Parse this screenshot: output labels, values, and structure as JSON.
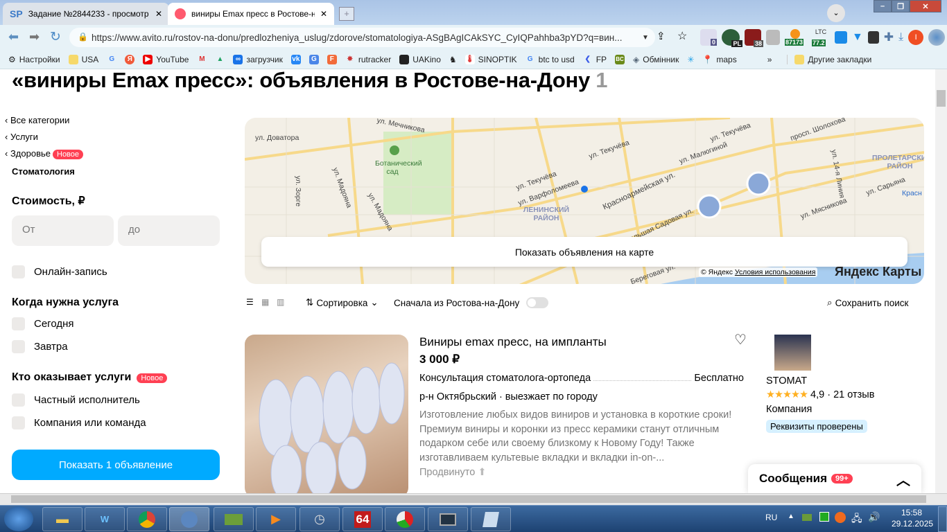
{
  "browser": {
    "tabs": [
      {
        "label": "Задание №2844233 - просмотр з",
        "icon": "SP"
      },
      {
        "label": "виниры Emax пресс в Ростове-на",
        "active": true
      }
    ],
    "url": "https://www.avito.ru/rostov-na-donu/predlozheniya_uslug/zdorove/stomatologiya-ASgBAgICAkSYC_CyIQPahhba3pYD?q=вин...",
    "extensions": {
      "weather": "0",
      "pl": "PL",
      "ublock": "38",
      "btc": "87173",
      "ltc_label": "LTC",
      "ltc": "77.2",
      "profile": "I"
    },
    "bookmarks": [
      "Настройки",
      "USA",
      "",
      "",
      "YouTube",
      "",
      "",
      "загрузчик",
      "",
      "",
      "",
      "rutracker",
      "UAKino",
      "",
      "SINOPTIK",
      "btc to usd",
      "FP",
      "BC",
      "Обмінник",
      "",
      "maps"
    ],
    "other_bookmarks": "Другие закладки",
    "more": "»"
  },
  "page": {
    "title": "«виниры Emax пресс»: объявления в Ростове-на-Дону",
    "count": "1",
    "breadcrumbs": [
      "Все категории",
      "Услуги",
      "Здоровье"
    ],
    "new_badge": "Новое",
    "current_category": "Стоматология",
    "price_label": "Стоимость, ₽",
    "price_from": "От",
    "price_to": "до",
    "online_booking": "Онлайн-запись",
    "when_label": "Когда нужна услуга",
    "when_options": [
      "Сегодня",
      "Завтра"
    ],
    "who_label": "Кто оказывает услуги",
    "who_options": [
      "Частный исполнитель",
      "Компания или команда"
    ],
    "show_button": "Показать 1 объявление",
    "map": {
      "button": "Показать объявления на карте",
      "copyright": "© Яндекс",
      "terms": "Условия использования",
      "logo": "Яндекс Карты",
      "labels": [
        "ул. Мечникова",
        "ул. Доватора",
        "Ботанический сад",
        "ул. Текучёва",
        "ул. Текучёва",
        "ул. Текучёва",
        "ул. Малюгиной",
        "просп. Шолохова",
        "ул. Варфоломеева",
        "Красноармейская ул.",
        "ЛЕНИНСКИЙ РАЙОН",
        "ПРОЛЕТАРСКИЙ РАЙОН",
        "ул. 14-я Линия",
        "ул. Сарьяна",
        "ул. Мясникова",
        "Большая Садовая ул.",
        "ул. Мадояна",
        "ул. Мадояна",
        "ул. Зорге",
        "Береговая ул.",
        "Красн"
      ]
    },
    "sort_label": "Сортировка",
    "local_first": "Сначала из Ростова-на-Дону",
    "save_search": "Сохранить поиск",
    "listing": {
      "title": "Виниры emax пресс, на импланты",
      "price": "3 000 ₽",
      "service": "Консультация стоматолога-ортопеда",
      "service_price": "Бесплатно",
      "location": "р-н Октябрьский · выезжает по городу",
      "description": "Изготовление любых видов виниров и установка в короткие сроки! Премиум виниры и коронки из пресс керамики станут отличным подарком себе или своему близкому к Новому Году! Также изготавливаем культевые вкладки и вкладки in-on-...",
      "promoted": "Продвинуто",
      "seller": "STOMAT",
      "rating": 4.9,
      "rating_text": "4,9 · 21 отзыв",
      "seller_type": "Компания",
      "verified": "Реквизиты проверены"
    },
    "messages": "Сообщения",
    "messages_count": "99+"
  },
  "taskbar": {
    "lang": "RU",
    "time": "15:58",
    "date": "29.12.2025",
    "app64": "64"
  },
  "colors": {
    "accent": "#00aaff",
    "badge": "#ff4053",
    "verified_bg": "#d6f0ff"
  }
}
